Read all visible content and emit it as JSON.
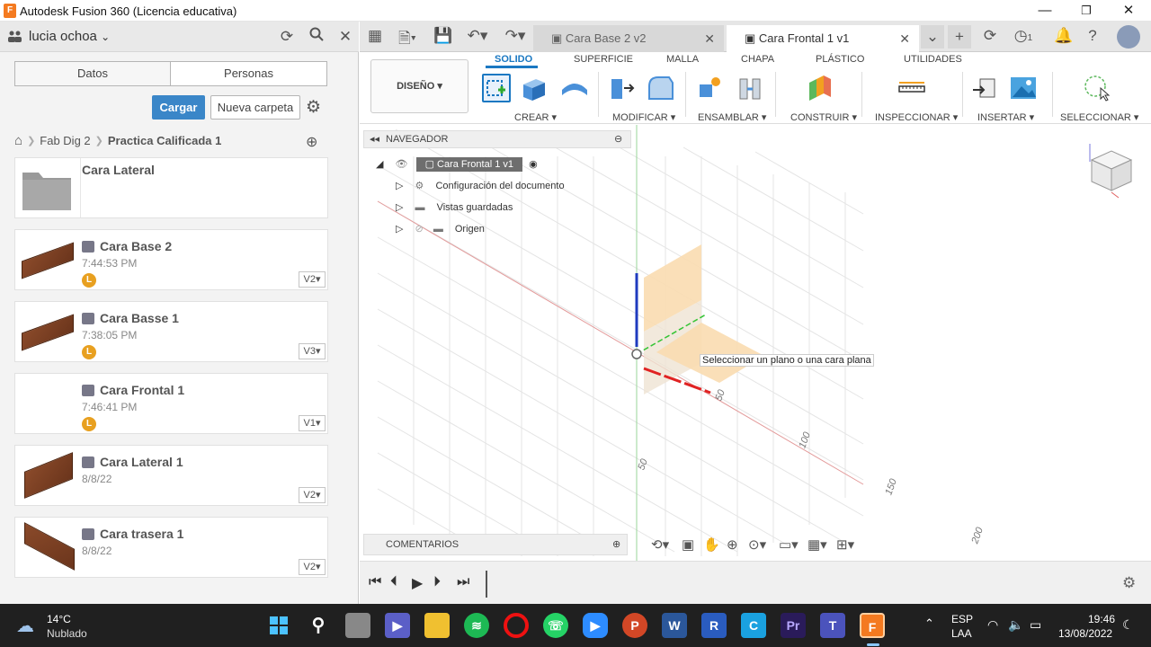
{
  "window": {
    "title": "Autodesk Fusion 360 (Licencia educativa)",
    "app_icon": "F",
    "minimize": "—",
    "maximize": "❐",
    "close": "✕"
  },
  "left_panel": {
    "user": "lucia ochoa",
    "tabs": [
      "Datos",
      "Personas"
    ],
    "upload_label": "Cargar",
    "new_folder_label": "Nueva carpeta",
    "breadcrumb": [
      "Fab Dig 2",
      "Practica Calificada 1"
    ],
    "items": [
      {
        "name": "Cara Lateral",
        "type": "folder"
      },
      {
        "name": "Cara Base 2",
        "time": "7:44:53 PM",
        "badge": "L",
        "version": "V2▾",
        "thumb": "plank-flat"
      },
      {
        "name": "Cara Basse 1",
        "time": "7:38:05 PM",
        "badge": "L",
        "version": "V3▾",
        "thumb": "plank-flat"
      },
      {
        "name": "Cara Frontal 1",
        "time": "7:46:41 PM",
        "badge": "L",
        "version": "V1▾",
        "thumb": "none"
      },
      {
        "name": "Cara Lateral 1",
        "time": "8/8/22",
        "badge": "",
        "version": "V2▾",
        "thumb": "plank-upright"
      },
      {
        "name": "Cara trasera 1",
        "time": "8/8/22",
        "badge": "",
        "version": "V2▾",
        "thumb": "plank-tilted"
      }
    ]
  },
  "doc_tabs": [
    {
      "label": "Cara Base 2 v2",
      "active": false
    },
    {
      "label": "Cara Frontal 1 v1",
      "active": true
    }
  ],
  "job_count": "1",
  "ribbon": {
    "workspace": "DISEÑO ▾",
    "tabs": [
      "SOLIDO",
      "SUPERFICIE",
      "MALLA",
      "CHAPA",
      "PLÁSTICO",
      "UTILIDADES"
    ],
    "active_tab": "SOLIDO",
    "groups": [
      "CREAR ▾",
      "MODIFICAR ▾",
      "ENSAMBLAR ▾",
      "CONSTRUIR ▾",
      "INSPECCIONAR ▾",
      "INSERTAR ▾",
      "SELECCIONAR ▾"
    ]
  },
  "navigator": {
    "title": "NAVEGADOR",
    "root": "Cara Frontal 1 v1",
    "rows": [
      "Configuración del documento",
      "Vistas guardadas",
      "Origen"
    ]
  },
  "viewport": {
    "tooltip": "Seleccionar un plano o una cara plana",
    "axis_labels": [
      "50",
      "100",
      "150",
      "200",
      "50"
    ]
  },
  "comments_label": "COMENTARIOS",
  "taskbar": {
    "weather_temp": "14°C",
    "weather_desc": "Nublado",
    "lang_top": "ESP",
    "lang_bottom": "LAA",
    "time": "19:46",
    "date": "13/08/2022",
    "apps": [
      "windows-start",
      "search",
      "files",
      "meet",
      "explorer",
      "spotify",
      "opera",
      "whatsapp",
      "zoom",
      "powerpoint",
      "word",
      "revit",
      "clipchamp",
      "premiere",
      "teams",
      "fusion360"
    ]
  },
  "colors": {
    "accent": "#1a78c2",
    "upload": "#3a86c8",
    "badge": "#e8a020",
    "fusion": "#f47a20"
  }
}
